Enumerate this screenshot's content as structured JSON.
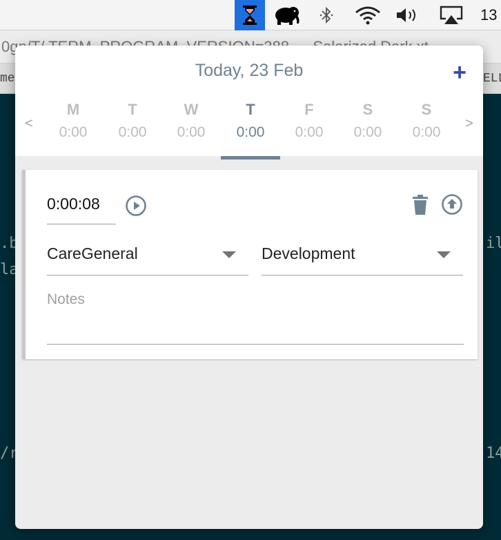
{
  "menubar": {
    "icons": [
      "hourglass-icon",
      "elephant-icon",
      "bluetooth-icon",
      "wifi-icon",
      "volume-icon",
      "airplay-icon"
    ],
    "clock_text": "13",
    "highlight_color": "#1f6fe0"
  },
  "terminal": {
    "title_text": "0gn/T/ TERM_PROGRAM_VERSION=388 — Solarized Dark xt",
    "tab_left": "me",
    "tab_right": "ELL",
    "lines": [
      ".b",
      "la",
      "/r"
    ],
    "right_lines": [
      "il",
      "14"
    ],
    "background_color": "#002b36"
  },
  "app": {
    "date_title": "Today, 23 Feb",
    "add_label": "+",
    "prev_label": "<",
    "next_label": ">",
    "days": [
      {
        "letter": "M",
        "time": "0:00",
        "active": false
      },
      {
        "letter": "T",
        "time": "0:00",
        "active": false
      },
      {
        "letter": "W",
        "time": "0:00",
        "active": false
      },
      {
        "letter": "T",
        "time": "0:00",
        "active": true
      },
      {
        "letter": "F",
        "time": "0:00",
        "active": false
      },
      {
        "letter": "S",
        "time": "0:00",
        "active": false
      },
      {
        "letter": "S",
        "time": "0:00",
        "active": false
      }
    ],
    "accent_color": "#6f8294",
    "add_color": "#3949ab",
    "entry": {
      "timer": "0:00:08",
      "project": "CareGeneral",
      "category": "Development",
      "notes_placeholder": "Notes"
    }
  }
}
